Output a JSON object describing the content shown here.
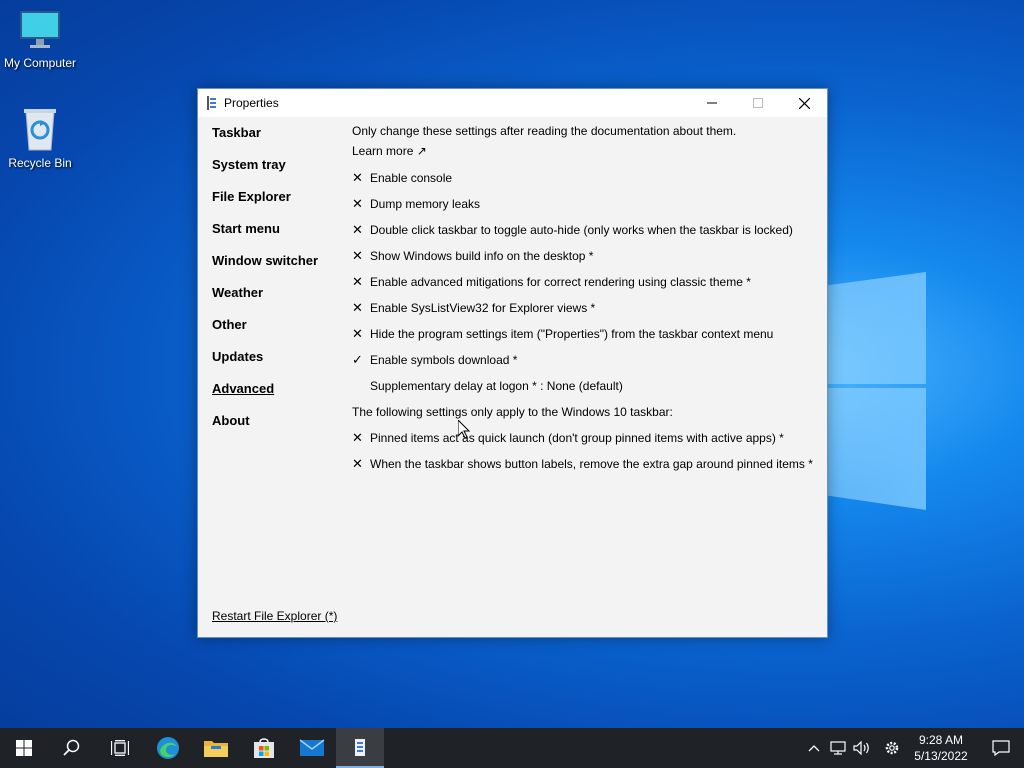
{
  "desktop": {
    "icons": [
      {
        "label": "My Computer"
      },
      {
        "label": "Recycle Bin"
      }
    ]
  },
  "window": {
    "title": "Properties",
    "sidebar": [
      {
        "label": "Taskbar"
      },
      {
        "label": "System tray"
      },
      {
        "label": "File Explorer"
      },
      {
        "label": "Start menu"
      },
      {
        "label": "Window switcher"
      },
      {
        "label": "Weather"
      },
      {
        "label": "Other"
      },
      {
        "label": "Updates"
      },
      {
        "label": "Advanced",
        "active": true
      },
      {
        "label": "About"
      }
    ],
    "intro": "Only change these settings after reading the documentation about them.",
    "learn_more": "Learn more ↗",
    "settings": [
      {
        "mark": "✕",
        "label": "Enable console"
      },
      {
        "mark": "✕",
        "label": "Dump memory leaks"
      },
      {
        "mark": "✕",
        "label": "Double click taskbar to toggle auto-hide (only works when the taskbar is locked)"
      },
      {
        "mark": "✕",
        "label": "Show Windows build info on the desktop *"
      },
      {
        "mark": "✕",
        "label": "Enable advanced mitigations for correct rendering using classic theme *"
      },
      {
        "mark": "✕",
        "label": "Enable SysListView32 for Explorer views *"
      },
      {
        "mark": "✕",
        "label": "Hide the program settings item (\"Properties\") from the taskbar context menu"
      },
      {
        "mark": "✓",
        "label": "Enable symbols download *"
      },
      {
        "mark": "",
        "label": "Supplementary delay at logon * : None (default)"
      }
    ],
    "section_win10": "The following settings only apply to the Windows 10 taskbar:",
    "settings_win10": [
      {
        "mark": "✕",
        "label": "Pinned items act as quick launch (don't group pinned items with active apps) *"
      },
      {
        "mark": "✕",
        "label": "When the taskbar shows button labels, remove the extra gap around pinned items *"
      }
    ],
    "restart_link": "Restart File Explorer (*)"
  },
  "taskbar": {
    "time": "9:28 AM",
    "date": "5/13/2022",
    "accent": "#7fb2e0"
  }
}
